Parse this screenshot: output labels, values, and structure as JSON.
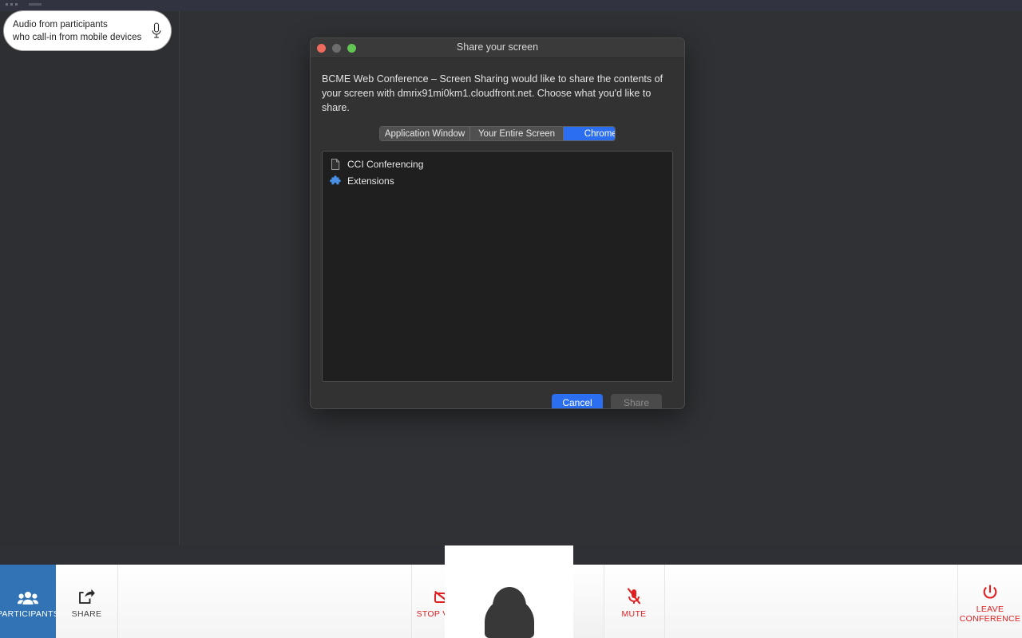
{
  "desktop": {
    "background_color": "#2f3134",
    "topbar_color": "#313440"
  },
  "tooltip": {
    "name": "audio-participants-tooltip",
    "line1": "Audio from participants",
    "line2": "who call-in from mobile devices",
    "icon": "microphone-icon"
  },
  "dialog": {
    "title": "Share your screen",
    "description": "BCME Web Conference – Screen Sharing would like to share the contents of your screen with dmrix91mi0km1.cloudfront.net. Choose what you'd like to share.",
    "window_controls": {
      "close": "close-traffic-light",
      "minimize": "minimize-traffic-light",
      "maximize": "maximize-traffic-light"
    },
    "tabs": [
      {
        "label": "Application Window",
        "active": false
      },
      {
        "label": "Your Entire Screen",
        "active": false
      },
      {
        "label": "Chrome Tab",
        "active": true
      }
    ],
    "active_tab_color": "#2b6ef0",
    "sources": [
      {
        "label": "CCI Conferencing",
        "icon": "page-icon"
      },
      {
        "label": "Extensions",
        "icon": "puzzle-piece-icon"
      }
    ],
    "buttons": {
      "cancel": "Cancel",
      "share": "Share",
      "share_enabled": false
    }
  },
  "toolbar": {
    "accent_blue": "#3173b4",
    "accent_red": "#e02020",
    "items": [
      {
        "label": "PARTICIPANTS",
        "icon": "participants-icon",
        "active": true
      },
      {
        "label": "SHARE",
        "icon": "share-icon",
        "active": false
      },
      {
        "label": "STOP VIDEO",
        "icon": "video-off-icon",
        "active": false
      },
      {
        "label": "MUTE",
        "icon": "mic-off-icon",
        "active": false
      },
      {
        "label": "LEAVE CONFERENCE",
        "icon": "power-icon",
        "active": false
      }
    ],
    "leave_label_line1": "LEAVE",
    "leave_label_line2": "CONFERENCE",
    "self_view": {
      "name": "self-video-tile",
      "avatar": "person-placeholder-icon"
    }
  }
}
